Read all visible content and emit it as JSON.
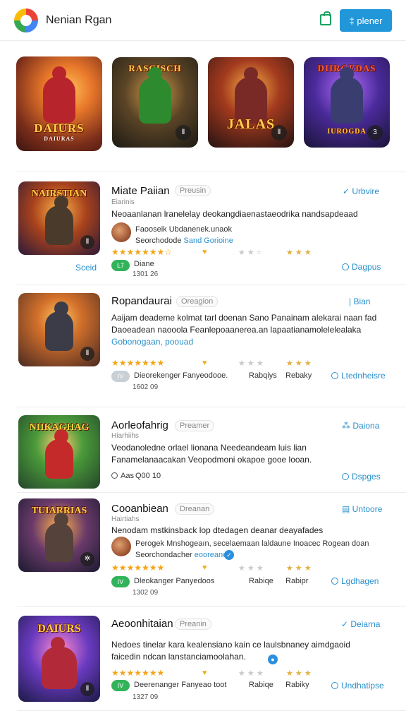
{
  "header": {
    "app_title": "Nenian Rgan",
    "store_icon": "shopping-bag-icon",
    "action_button": "‡ plener"
  },
  "carousel": [
    {
      "title": "DAIURS",
      "subtitle": "DAIURAS",
      "badge": ""
    },
    {
      "title": "RASCISCH",
      "subtitle": "",
      "badge": "Ⅱ"
    },
    {
      "title": "JALAS",
      "subtitle": "",
      "badge": "Ⅱ"
    },
    {
      "title": "DIIRGEDAS",
      "subtitle": "IUROGDA",
      "badge": "3"
    }
  ],
  "rows": [
    {
      "thumb_title": "NAIRSTIAN",
      "name": "Miate Paiian",
      "pill": "Preusin",
      "right_top": "✓ Urbvire",
      "sub1": "Eiarinis",
      "desc": "Neoaanlanan lranelelay deokangdiaenastaeodrika nandsapdeaad",
      "dev_line1": "Faooseik Ubdanenek.unaok",
      "dev_line2_a": "Seorchodode ",
      "dev_line2_b": "Sand Gorioine",
      "stars_note": "★★★★★★★☆",
      "heart": "♥",
      "right_meta": "★ ★ ★",
      "tag": "Ŀ7",
      "tag_text": "Diane",
      "small": "1301 26",
      "left_action": "Sceid",
      "right_action": "Dagpus"
    },
    {
      "thumb_title": "",
      "name": "Ropandaurai",
      "pill": "Oreagion",
      "right_top": "| Bian",
      "desc": "Aaijam deademe kolmat tarl doenan Sano Panainam alekarai naan fad Daoeadean naooola Feanlepoaanerea.an lapaatianamolelelealaka",
      "desc_link_a": "Gobonogaan,",
      "desc_link_b": "poouad",
      "tag": "IV",
      "tag_text": "Dieorekenger Fanyeodooe.",
      "meta2": "Rabqiys",
      "meta3": "Rebaky",
      "small": "1602 09",
      "right_action": "Ltednheisre"
    },
    {
      "thumb_title": "NIIKAGHAG",
      "name": "Aorleofahrig",
      "pill": "Preamer",
      "right_top": "⁂ Daiona",
      "sub1": "Hiarhiihs",
      "desc": "Veodanoledne orlael lionana Needeandeam luis lian Fanamelanaacakan Veopodmoni okapoe gooe looan.",
      "meta_left": "Aas",
      "small": "Q00 10",
      "right_action": "Dspges"
    },
    {
      "thumb_title": "TUIARRIAS",
      "name": "Cooanbiean",
      "pill": "Dreanan",
      "right_top": "▤ Untoore",
      "sub1": "Hairtiahs",
      "desc": "Nenodam mstkinsback lop dtedagen deanar deayafades",
      "dev_line1": "Perogek Mnshogeaın, secelaemaan laldaune Inoacec Rogean doan",
      "dev_line2_a": "Seorchondacher ",
      "dev_line2_b": "eooreane,",
      "tag": "IV",
      "tag_text": "Dleokanger Panyedoos",
      "meta2": "Rabiqe",
      "meta3": "Rabipr",
      "small": "1302 09",
      "right_action": "Lgdhagen"
    },
    {
      "thumb_title": "DAIURS",
      "name": "Aeoonhitaian",
      "pill": "Preanin",
      "right_top": "✓ Deiarna",
      "desc": "Nedoes tinelar kara kealensiano kain ce laulsbnaney aimdgaoid faicedin ndcan lanstanciamoolahan.",
      "tag": "IV",
      "tag_text": "Deerenanger Fanyeao toot",
      "meta2": "Rabiqe",
      "meta3": "Rabiky",
      "small": "1327 09",
      "right_action": "Undhatipse"
    }
  ]
}
